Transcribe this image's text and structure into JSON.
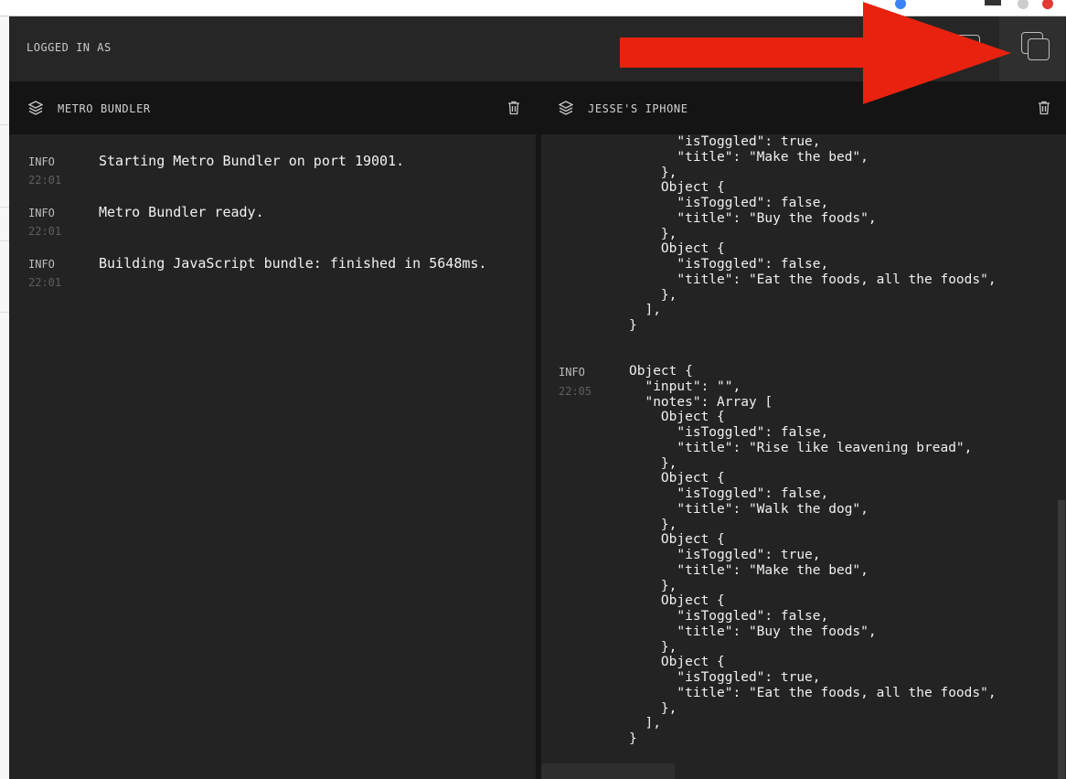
{
  "header": {
    "logged_in_label": "LOGGED IN AS"
  },
  "panes": {
    "left": {
      "title": "METRO BUNDLER",
      "logs": [
        {
          "level": "INFO",
          "time": "22:01",
          "message": "Starting Metro Bundler on port 19001."
        },
        {
          "level": "INFO",
          "time": "22:01",
          "message": "Metro Bundler ready."
        },
        {
          "level": "INFO",
          "time": "22:01",
          "message": "Building JavaScript bundle: finished in 5648ms."
        }
      ]
    },
    "right": {
      "title": "JESSE'S IPHONE",
      "previous_tail": "      \"isToggled\": true,\n      \"title\": \"Make the bed\",\n    },\n    Object {\n      \"isToggled\": false,\n      \"title\": \"Buy the foods\",\n    },\n    Object {\n      \"isToggled\": false,\n      \"title\": \"Eat the foods, all the foods\",\n    },\n  ],\n}",
      "entry": {
        "level": "INFO",
        "time": "22:05",
        "message": "Object {\n  \"input\": \"\",\n  \"notes\": Array [\n    Object {\n      \"isToggled\": false,\n      \"title\": \"Rise like leavening bread\",\n    },\n    Object {\n      \"isToggled\": false,\n      \"title\": \"Walk the dog\",\n    },\n    Object {\n      \"isToggled\": true,\n      \"title\": \"Make the bed\",\n    },\n    Object {\n      \"isToggled\": false,\n      \"title\": \"Buy the foods\",\n    },\n    Object {\n      \"isToggled\": true,\n      \"title\": \"Eat the foods, all the foods\",\n    },\n  ],\n}"
      }
    }
  },
  "icons": {
    "pane_icon": "layers-icon",
    "clear_icon": "trash-icon",
    "header_single": "square-icon",
    "header_multi": "multi-window-icon",
    "annotation": "red-arrow"
  },
  "colors": {
    "background": "#232323",
    "pane_header": "#141414",
    "annotation_arrow": "#e8220f"
  }
}
